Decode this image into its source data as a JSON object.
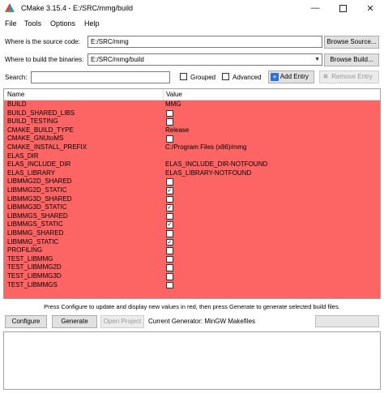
{
  "window": {
    "title": "CMake 3.15.4 - E:/SRC/mmg/build"
  },
  "menu": [
    "File",
    "Tools",
    "Options",
    "Help"
  ],
  "source": {
    "label": "Where is the source code:",
    "value": "E:/SRC/mmg",
    "button": "Browse Source..."
  },
  "build": {
    "label": "Where to build the binaries:",
    "value": "E:/SRC/mmg/build",
    "button": "Browse Build..."
  },
  "search": {
    "label": "Search:",
    "value": "",
    "grouped_label": "Grouped",
    "advanced_label": "Advanced",
    "add_entry": "Add Entry",
    "remove_entry": "Remove Entry"
  },
  "table": {
    "headers": {
      "name": "Name",
      "value": "Value"
    },
    "row_color": "#fd6565",
    "rows": [
      {
        "name": "BUILD",
        "value": "MMG"
      },
      {
        "name": "BUILD_SHARED_LIBS",
        "checkbox": true,
        "checked": false
      },
      {
        "name": "BUILD_TESTING",
        "checkbox": true,
        "checked": false
      },
      {
        "name": "CMAKE_BUILD_TYPE",
        "value": "Release"
      },
      {
        "name": "CMAKE_GNUtoMS",
        "checkbox": true,
        "checked": false
      },
      {
        "name": "CMAKE_INSTALL_PREFIX",
        "value": "C:/Program Files (x86)/mmg"
      },
      {
        "name": "ELAS_DIR",
        "value": ""
      },
      {
        "name": "ELAS_INCLUDE_DIR",
        "value": "ELAS_INCLUDE_DIR-NOTFOUND"
      },
      {
        "name": "ELAS_LIBRARY",
        "value": "ELAS_LIBRARY-NOTFOUND"
      },
      {
        "name": "LIBMMG2D_SHARED",
        "checkbox": true,
        "checked": false
      },
      {
        "name": "LIBMMG2D_STATIC",
        "checkbox": true,
        "checked": true
      },
      {
        "name": "LIBMMG3D_SHARED",
        "checkbox": true,
        "checked": false
      },
      {
        "name": "LIBMMG3D_STATIC",
        "checkbox": true,
        "checked": true
      },
      {
        "name": "LIBMMGS_SHARED",
        "checkbox": true,
        "checked": false
      },
      {
        "name": "LIBMMGS_STATIC",
        "checkbox": true,
        "checked": true
      },
      {
        "name": "LIBMMG_SHARED",
        "checkbox": true,
        "checked": false
      },
      {
        "name": "LIBMMG_STATIC",
        "checkbox": true,
        "checked": true
      },
      {
        "name": "PROFILING",
        "checkbox": true,
        "checked": false
      },
      {
        "name": "TEST_LIBMMG",
        "checkbox": true,
        "checked": false
      },
      {
        "name": "TEST_LIBMMG2D",
        "checkbox": true,
        "checked": false
      },
      {
        "name": "TEST_LIBMMG3D",
        "checkbox": true,
        "checked": false
      },
      {
        "name": "TEST_LIBMMGS",
        "checkbox": true,
        "checked": false
      }
    ]
  },
  "status_text": "Press Configure to update and display new values in red, then press Generate to generate selected build files.",
  "actions": {
    "configure": "Configure",
    "generate": "Generate",
    "open_project": "Open Project",
    "generator_text": "Current Generator: MinGW Makefiles"
  },
  "icons": {
    "app": "cmake-logo-icon",
    "add": "plus-icon",
    "remove": "x-icon"
  }
}
